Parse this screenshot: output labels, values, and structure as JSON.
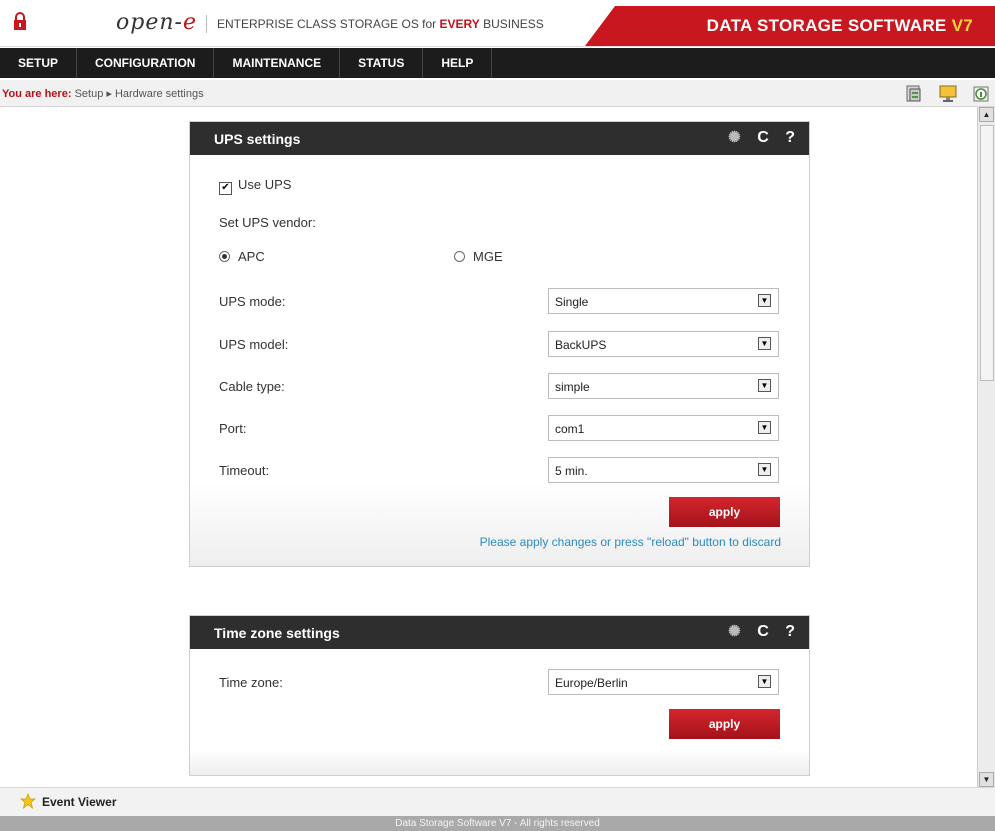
{
  "header": {
    "logo_text": "open-",
    "logo_e": "e",
    "tagline_prefix": "ENTERPRISE CLASS STORAGE OS for ",
    "tagline_highlight": "EVERY",
    "tagline_suffix": " BUSINESS",
    "brand_title": "DATA STORAGE SOFTWARE ",
    "brand_version": "V7"
  },
  "menu": [
    "SETUP",
    "CONFIGURATION",
    "MAINTENANCE",
    "STATUS",
    "HELP"
  ],
  "breadcrumb": {
    "label": "You are here:",
    "path": "Setup ▸ Hardware settings"
  },
  "ups": {
    "title": "UPS settings",
    "use_ups_label": "Use UPS",
    "use_ups_checked": true,
    "vendor_label": "Set UPS vendor:",
    "vendor_apc": "APC",
    "vendor_mge": "MGE",
    "vendor_selected": "APC",
    "mode_label": "UPS mode:",
    "mode_value": "Single",
    "model_label": "UPS model:",
    "model_value": "BackUPS",
    "cable_label": "Cable type:",
    "cable_value": "simple",
    "port_label": "Port:",
    "port_value": "com1",
    "timeout_label": "Timeout:",
    "timeout_value": "5 min.",
    "apply_label": "apply",
    "hint": "Please apply changes or press \"reload\" button to discard"
  },
  "timezone": {
    "title": "Time zone settings",
    "tz_label": "Time zone:",
    "tz_value": "Europe/Berlin",
    "apply_label": "apply"
  },
  "panel_icons": {
    "reload": "C",
    "help": "?"
  },
  "statusbar": {
    "event_viewer": "Event Viewer"
  },
  "footer": "Data Storage Software V7 - All rights reserved",
  "colors": {
    "accent": "#c8171e",
    "link": "#2a8bc3",
    "menu_bg": "#1c1c1c",
    "header_bg": "#2e2e2e"
  }
}
